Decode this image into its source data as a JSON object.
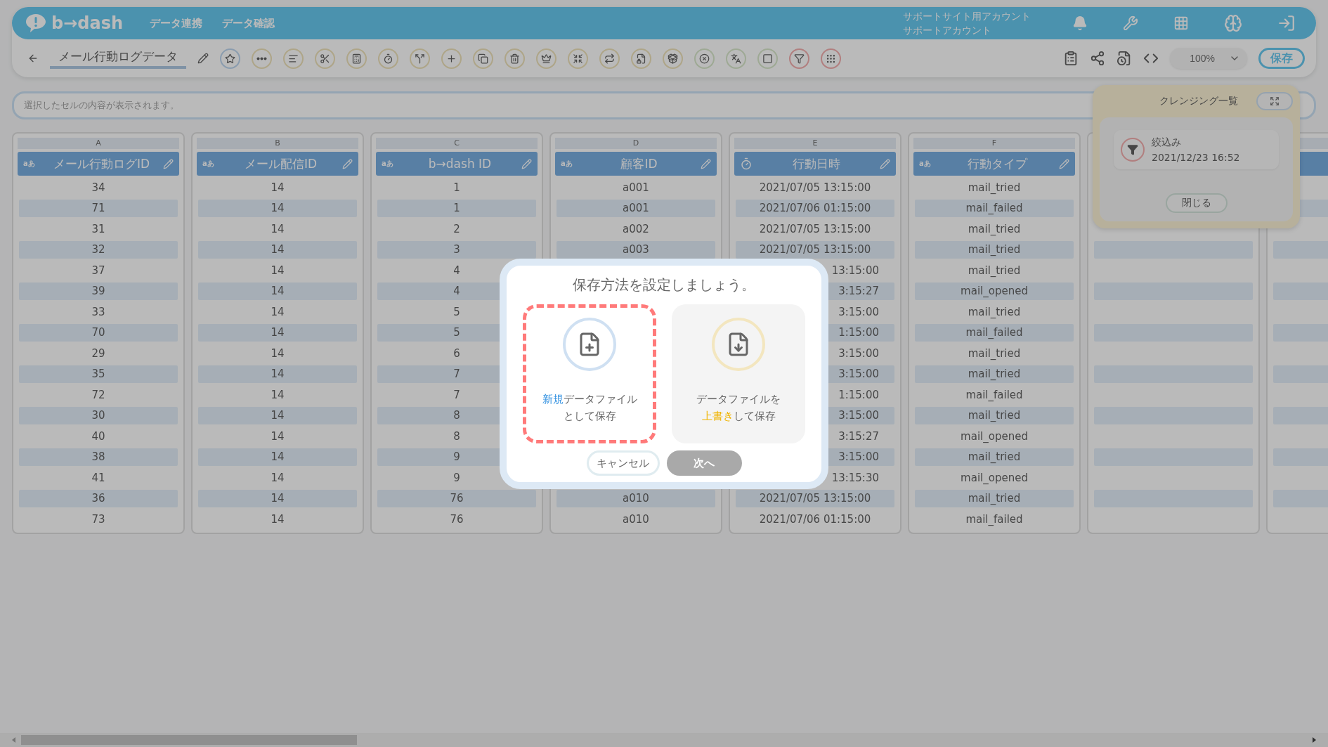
{
  "header": {
    "logo": "b→dash",
    "nav": [
      {
        "label": "データ連携"
      },
      {
        "label": "データ確認"
      }
    ],
    "account": [
      "サポートサイト用アカウント",
      "サポートアカウント"
    ]
  },
  "toolbar": {
    "title": "メール行動ログデータ",
    "zoom": "100%",
    "save": "保存"
  },
  "formula_bar": {
    "placeholder": "選択したセルの内容が表示されます。"
  },
  "columns": [
    {
      "kind": "text",
      "letter": "A",
      "type_label": "aあ",
      "title": "メール行動ログID",
      "cells": [
        "34",
        "71",
        "31",
        "32",
        "37",
        "39",
        "33",
        "70",
        "29",
        "35",
        "72",
        "30",
        "40",
        "38",
        "41",
        "36",
        "73"
      ]
    },
    {
      "kind": "text",
      "letter": "B",
      "type_label": "aあ",
      "title": "メール配信ID",
      "cells": [
        "14",
        "14",
        "14",
        "14",
        "14",
        "14",
        "14",
        "14",
        "14",
        "14",
        "14",
        "14",
        "14",
        "14",
        "14",
        "14",
        "14"
      ]
    },
    {
      "kind": "text",
      "letter": "C",
      "type_label": "aあ",
      "title": "b→dash ID",
      "cells": [
        "1",
        "1",
        "2",
        "3",
        "4",
        "4",
        "5",
        "5",
        "6",
        "7",
        "7",
        "8",
        "8",
        "9",
        "9",
        "76",
        "76"
      ]
    },
    {
      "kind": "text",
      "letter": "D",
      "type_label": "aあ",
      "title": "顧客ID",
      "cells": [
        "a001",
        "a001",
        "a002",
        "a003",
        null,
        null,
        null,
        null,
        null,
        null,
        null,
        null,
        null,
        null,
        null,
        "a010",
        "a010"
      ]
    },
    {
      "kind": "datetime",
      "letter": "E",
      "title": "行動日時",
      "cells": [
        "2021/07/05 13:15:00",
        "2021/07/06 01:15:00",
        "2021/07/05 13:15:00",
        "2021/07/05 13:15:00",
        {
          "text": "13:15:00",
          "clipped": true
        },
        {
          "text": "3:15:27",
          "clipped": true
        },
        {
          "text": "3:15:00",
          "clipped": true
        },
        {
          "text": "1:15:00",
          "clipped": true
        },
        {
          "text": "3:15:00",
          "clipped": true
        },
        {
          "text": "3:15:00",
          "clipped": true
        },
        {
          "text": "1:15:00",
          "clipped": true
        },
        {
          "text": "3:15:00",
          "clipped": true
        },
        {
          "text": "3:15:27",
          "clipped": true
        },
        {
          "text": "3:15:00",
          "clipped": true
        },
        {
          "text": "13:15:30",
          "clipped": true
        },
        "2021/07/05 13:15:00",
        "2021/07/06 01:15:00"
      ]
    },
    {
      "kind": "text",
      "letter": "F",
      "type_label": "aあ",
      "title": "行動タイプ",
      "cells": [
        "mail_tried",
        "mail_failed",
        "mail_tried",
        "mail_tried",
        "mail_tried",
        "mail_opened",
        "mail_tried",
        "mail_failed",
        "mail_tried",
        "mail_tried",
        "mail_failed",
        "mail_tried",
        "mail_opened",
        "mail_tried",
        "mail_opened",
        "mail_tried",
        "mail_failed"
      ]
    },
    {
      "kind": "blank"
    },
    {
      "kind": "blank"
    }
  ],
  "cleansing_panel": {
    "title": "クレンジング一覧",
    "items": [
      {
        "label": "絞込み",
        "time": "2021/12/23 16:52"
      }
    ],
    "close": "閉じる"
  },
  "modal": {
    "title": "保存方法を設定しましょう。",
    "options": [
      {
        "kind": "new",
        "selected": true,
        "color": "#2f8fe0",
        "lines": [
          [
            {
              "text": "新規",
              "accent": true
            },
            {
              "text": "データファイル",
              "accent": false
            }
          ],
          [
            {
              "text": "として保存",
              "accent": false
            }
          ]
        ]
      },
      {
        "kind": "overwrite",
        "selected": false,
        "color": "#f0b400",
        "lines": [
          [
            {
              "text": "データファイルを",
              "accent": false
            }
          ],
          [
            {
              "text": "上書き",
              "accent": true
            },
            {
              "text": "して保存",
              "accent": false
            }
          ]
        ]
      }
    ],
    "buttons": [
      {
        "label": "キャンセル",
        "disabled": false
      },
      {
        "label": "次へ",
        "disabled": true
      }
    ]
  }
}
